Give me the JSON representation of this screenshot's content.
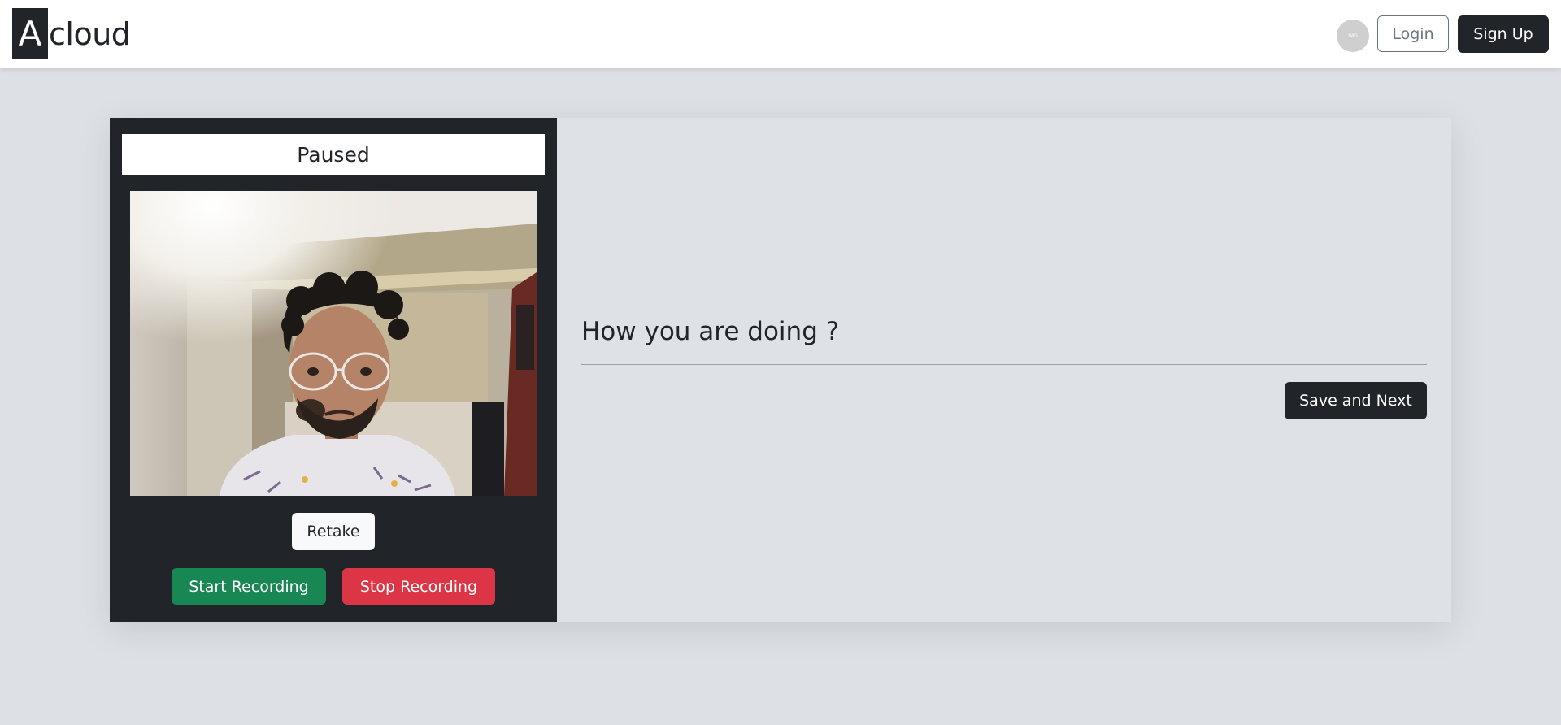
{
  "brand": {
    "mark": "A",
    "text": "cloud"
  },
  "nav": {
    "avatar_text": "IMG",
    "login_label": "Login",
    "signup_label": "Sign Up"
  },
  "recorder": {
    "status": "Paused",
    "retake_label": "Retake",
    "start_label": "Start Recording",
    "stop_label": "Stop Recording"
  },
  "question": {
    "text": "How you are doing ?",
    "save_label": "Save and Next"
  },
  "colors": {
    "page_bg": "#dde0e5",
    "dark": "#212529",
    "success": "#198754",
    "danger": "#dc3545",
    "panel_bg": "#dee1e6"
  }
}
